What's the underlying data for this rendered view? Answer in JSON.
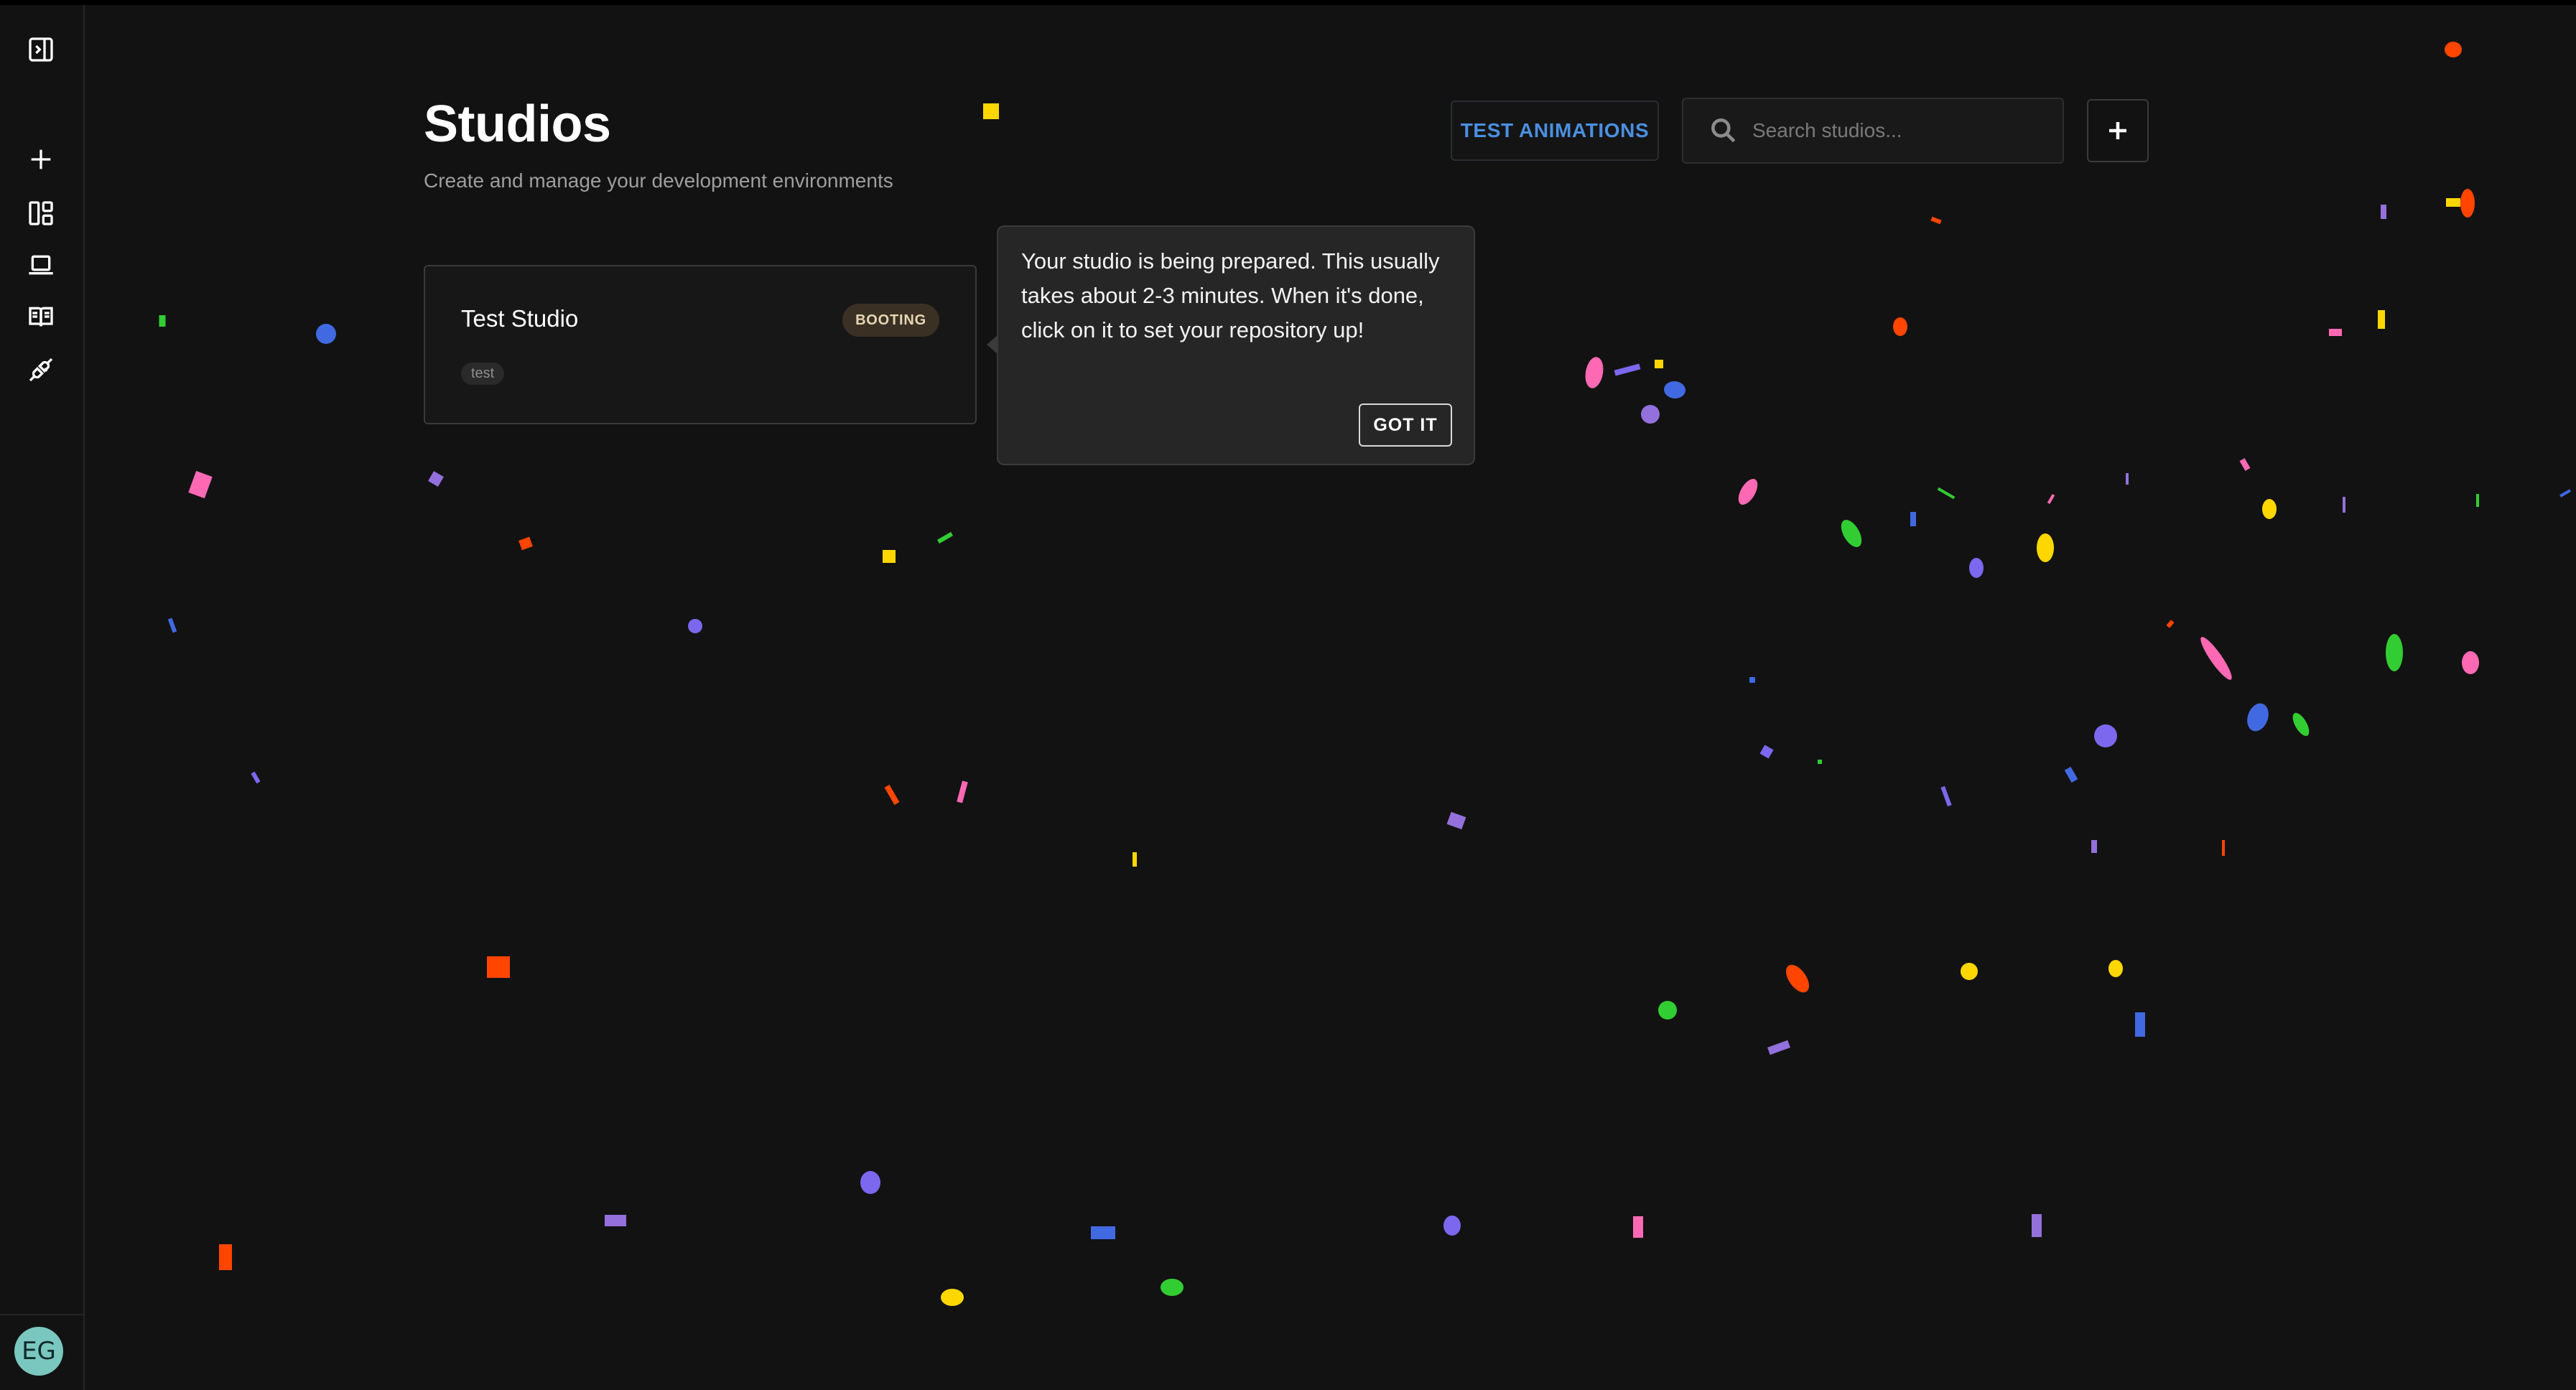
{
  "header": {
    "title": "Studios",
    "subtitle": "Create and manage your development environments"
  },
  "toolbar": {
    "test_animations_label": "TEST ANIMATIONS",
    "search_placeholder": "Search studios...",
    "add_icon": "plus-icon"
  },
  "sidebar": {
    "items": [
      {
        "icon": "collapse-sidebar-icon"
      },
      {
        "icon": "plus-icon"
      },
      {
        "icon": "dashboard-icon"
      },
      {
        "icon": "laptop-icon"
      },
      {
        "icon": "book-icon"
      },
      {
        "icon": "plug-icon"
      }
    ],
    "avatar_initials": "EG",
    "avatar_color": "#7ac7bf"
  },
  "studios": [
    {
      "name": "Test Studio",
      "status": "BOOTING",
      "tag": "test"
    }
  ],
  "tooltip": {
    "text": "Your studio is being prepared. This usually takes about 2-3 minutes. When it's done, click on it to set your repository up!",
    "button_label": "GOT IT"
  },
  "colors": {
    "background": "#121212",
    "accent": "#4b8fe0",
    "confetti": [
      "#ff4500",
      "#ffd700",
      "#7b68ee",
      "#4169e1",
      "#32cd32",
      "#ff69b4",
      "#9370db"
    ]
  }
}
